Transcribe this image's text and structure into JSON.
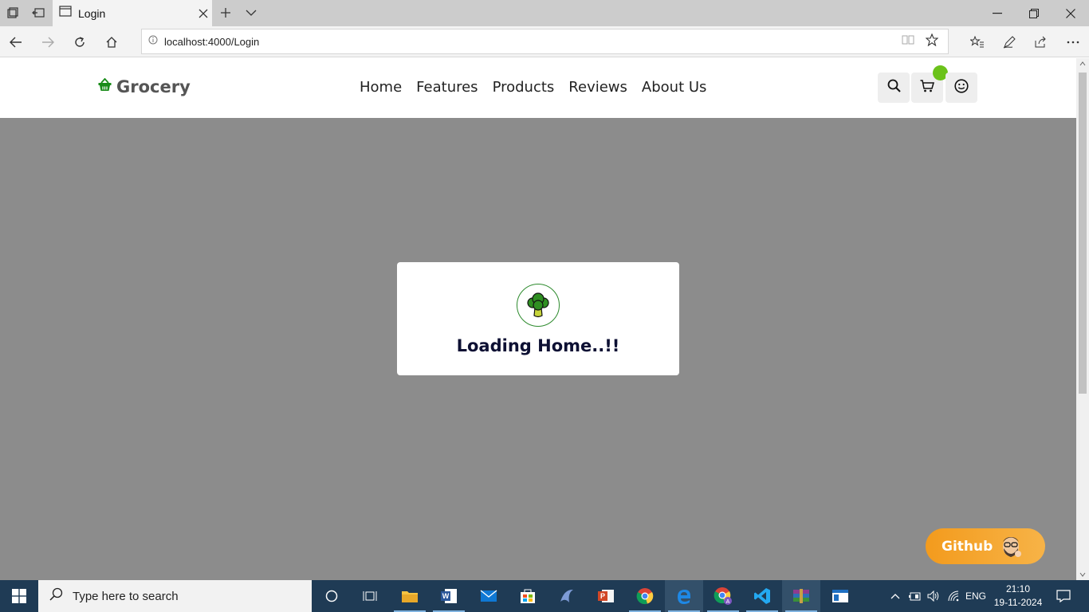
{
  "browser": {
    "tab_title": "Login",
    "url": "localhost:4000/Login"
  },
  "site": {
    "brand": "Grocery",
    "nav": [
      "Home",
      "Features",
      "Products",
      "Reviews",
      "About Us"
    ]
  },
  "loader": {
    "text": "Loading Home..!!"
  },
  "github_button": {
    "label": "Github"
  },
  "taskbar": {
    "search_placeholder": "Type here to search",
    "language": "ENG",
    "time": "21:10",
    "date": "19-11-2024"
  },
  "colors": {
    "brand_green": "#1a8c1a",
    "badge_green": "#6bc21a",
    "overlay": "#8c8c8c",
    "github_orange": "#f39b1d"
  },
  "icons": [
    "basket-icon",
    "search-icon",
    "cart-icon",
    "smile-icon",
    "broccoli-icon"
  ]
}
